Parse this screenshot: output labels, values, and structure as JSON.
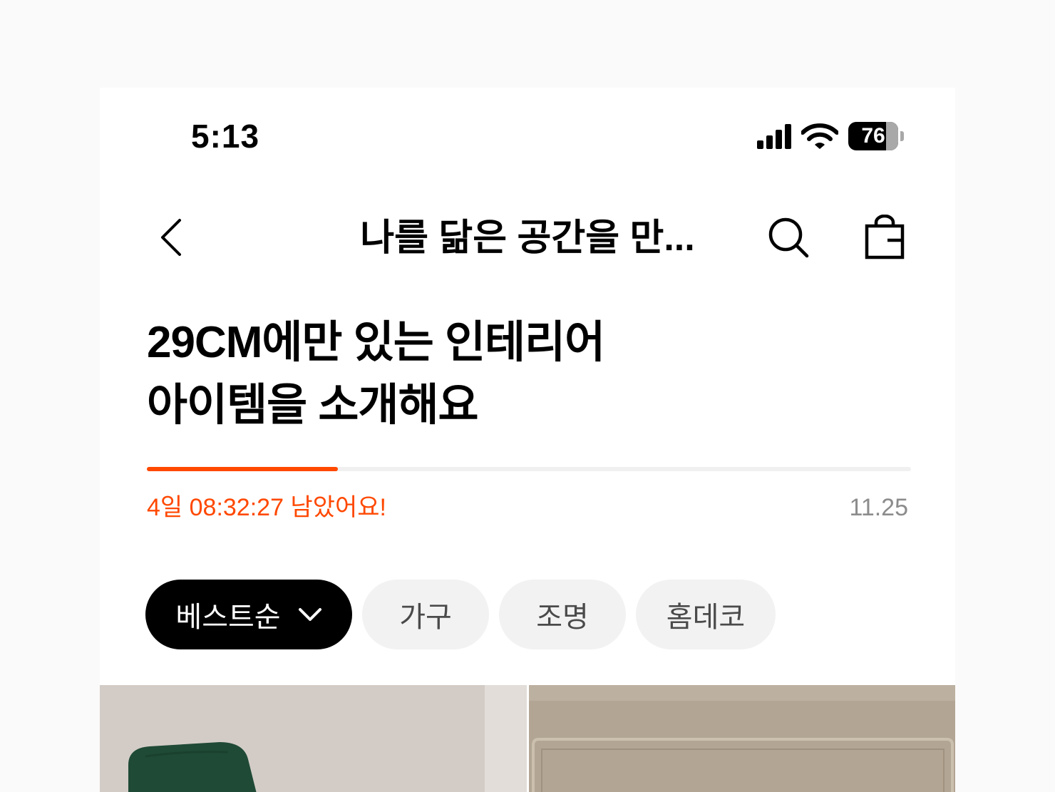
{
  "status_bar": {
    "time": "5:13",
    "battery": "76"
  },
  "nav": {
    "title": "나를 닮은 공간을 만..."
  },
  "headline": {
    "line1": "29CM에만 있는 인테리어",
    "line2": "아이템을 소개해요"
  },
  "progress": {
    "fraction": 0.25
  },
  "countdown": {
    "text": "4일 08:32:27 남았어요!",
    "date": "11.25"
  },
  "filters": {
    "sort_label": "베스트순",
    "chips": [
      "가구",
      "조명",
      "홈데코"
    ]
  },
  "colors": {
    "accent": "#ff4800",
    "chip_active_bg": "#000000",
    "chip_bg": "#f2f2f2"
  },
  "icons": {
    "back": "chevron-left-icon",
    "search": "search-icon",
    "cart": "shopping-bag-icon",
    "sort": "chevron-down-icon"
  }
}
